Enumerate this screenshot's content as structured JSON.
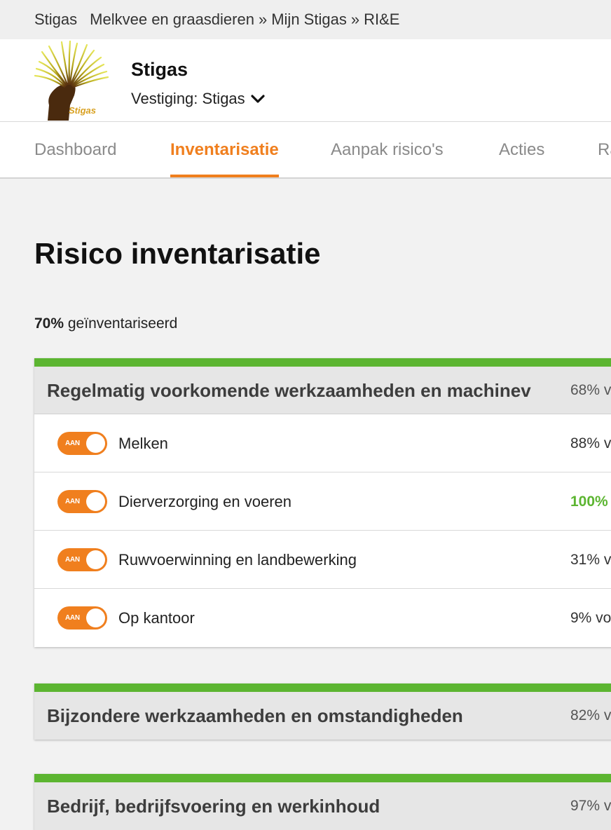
{
  "breadcrumb": {
    "site": "Stigas",
    "section": "Melkvee en graasdieren",
    "sep1": "»",
    "mijn": "Mijn Stigas",
    "sep2": "»",
    "current": "RI&E"
  },
  "header": {
    "logo_text": "Stigas",
    "org_name": "Stigas",
    "vestiging_label": "Vestiging: Stigas",
    "vestiging_icon": "chevron-down-icon"
  },
  "nav": {
    "tabs": [
      {
        "label": "Dashboard",
        "active": false
      },
      {
        "label": "Inventarisatie",
        "active": true
      },
      {
        "label": "Aanpak risico's",
        "active": false
      },
      {
        "label": "Acties",
        "active": false
      },
      {
        "label": "Ra",
        "active": false
      }
    ]
  },
  "main": {
    "title": "Risico inventarisatie",
    "progress_value": "70%",
    "progress_text": "geïnventariseerd"
  },
  "sections": [
    {
      "title": "Regelmatig voorkomende werkzaamheden en machinev",
      "percent": "68% v",
      "items": [
        {
          "toggle_label": "AAN",
          "label": "Melken",
          "percent": "88% v"
        },
        {
          "toggle_label": "AAN",
          "label": "Dierverzorging en voeren",
          "percent": "100%"
        },
        {
          "toggle_label": "AAN",
          "label": "Ruwvoerwinning en landbewerking",
          "percent": "31% v"
        },
        {
          "toggle_label": "AAN",
          "label": "Op kantoor",
          "percent": "9% vo"
        }
      ]
    },
    {
      "title": "Bijzondere werkzaamheden en omstandigheden",
      "percent": "82% v"
    },
    {
      "title": "Bedrijf, bedrijfsvoering en werkinhoud",
      "percent": "97% v"
    }
  ],
  "colors": {
    "accent": "#f07f1e",
    "complete_green": "#5cb531",
    "section_bar": "#5cb531"
  }
}
